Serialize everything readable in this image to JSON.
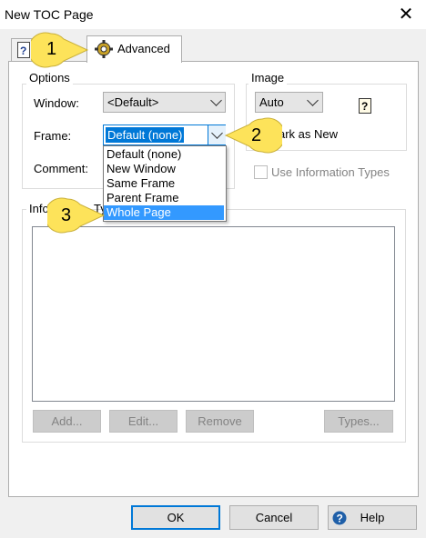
{
  "window": {
    "title": "New TOC Page"
  },
  "tabs": {
    "advanced_label": "Advanced"
  },
  "options": {
    "legend": "Options",
    "window_label": "Window:",
    "window_value": "<Default>",
    "frame_label": "Frame:",
    "frame_value": "Default (none)",
    "comment_label": "Comment:"
  },
  "frame_dropdown": {
    "items": [
      "Default (none)",
      "New Window",
      "Same Frame",
      "Parent Frame",
      "Whole Page"
    ],
    "selected": "Whole Page"
  },
  "image": {
    "legend": "Image",
    "value": "Auto",
    "mark_as_new": "ark as New"
  },
  "use_info_types": "Use Information Types",
  "info_types": {
    "legend_left": "Info",
    "legend_right": "Ty"
  },
  "list_buttons": {
    "add": "Add...",
    "edit": "Edit...",
    "remove": "Remove",
    "types": "Types..."
  },
  "footer": {
    "ok": "OK",
    "cancel": "Cancel",
    "help": "Help"
  },
  "callouts": {
    "one": "1",
    "two": "2",
    "three": "3"
  },
  "colors": {
    "callout_fill": "#fde35a",
    "selection": "#3399ff",
    "focus_border": "#0078d7"
  }
}
